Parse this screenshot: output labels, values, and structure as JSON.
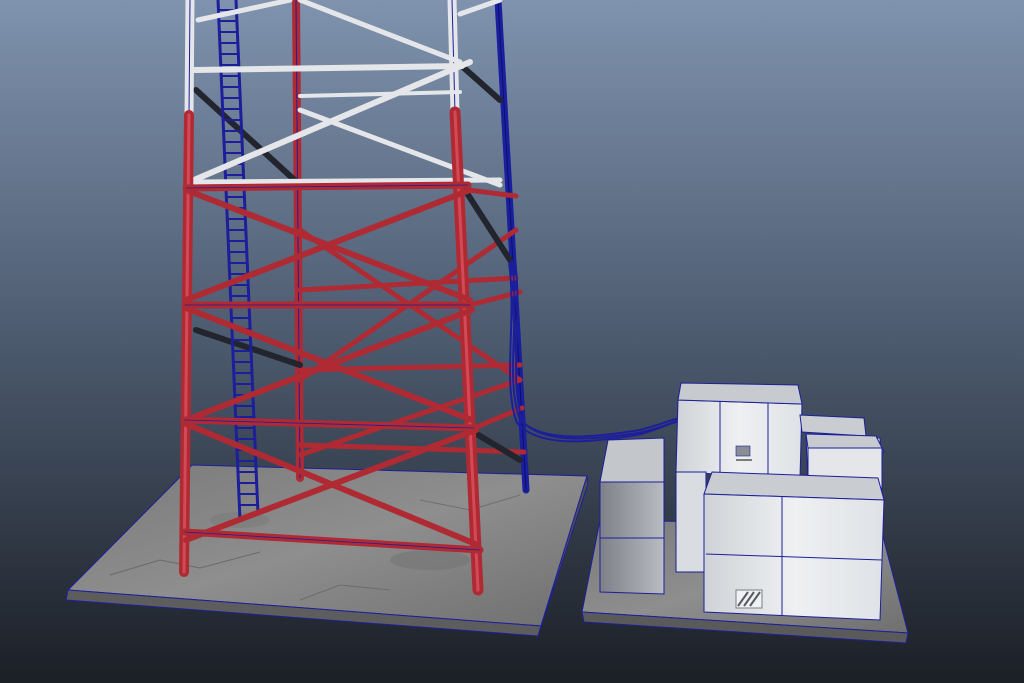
{
  "viewport": {
    "background_top": "#7f93ae",
    "background_mid": "#4c5a6e",
    "background_bottom": "#1b1f26"
  },
  "scene": {
    "objects": [
      "telecom-lattice-tower",
      "maintenance-ladder",
      "concrete-tower-pad",
      "equipment-pad",
      "equipment-cabinet-large",
      "equipment-cabinet-front",
      "equipment-cabinet-left",
      "equipment-cabinet-small",
      "cable-bundle"
    ],
    "colors": {
      "tower_red": "#b02a33",
      "tower_red_light": "#d14a55",
      "tower_white": "#e4e6ea",
      "tower_dark": "#23252e",
      "wireframe_blue": "#1d1f9a",
      "concrete": "#8c8c8c",
      "cabinet_face": "#e9ebee",
      "cabinet_side": "#b7bbc1"
    }
  }
}
